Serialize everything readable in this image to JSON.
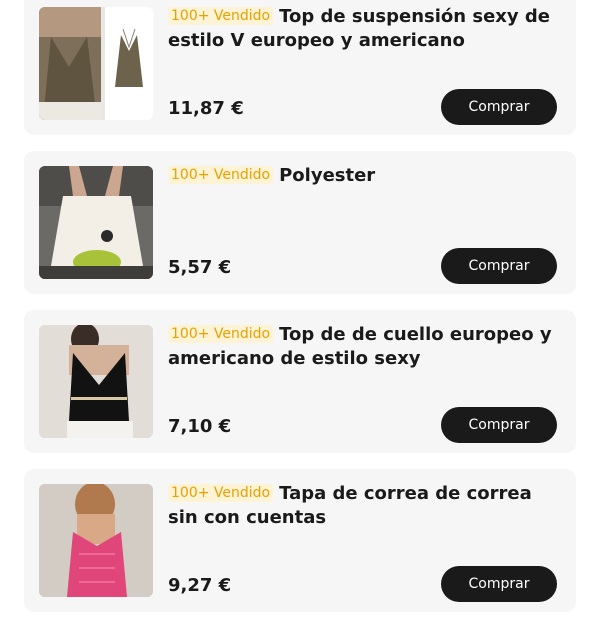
{
  "products": [
    {
      "badge": "100+ Vendido",
      "title": "Top de suspensión sexy de estilo V europeo y americano",
      "price": "11,87 €",
      "button": "Comprar",
      "image_label": "halter-top-olive-photo"
    },
    {
      "badge": "100+ Vendido",
      "title": "Polyester",
      "price": "5,57 €",
      "button": "Comprar",
      "image_label": "white-ruffle-cami-photo"
    },
    {
      "badge": "100+ Vendido",
      "title": "Top de de cuello europeo y americano de estilo sexy",
      "price": "7,10 €",
      "button": "Comprar",
      "image_label": "black-halter-knit-top-photo"
    },
    {
      "badge": "100+ Vendido",
      "title": "Tapa de correa de correa sin con cuentas",
      "price": "9,27 €",
      "button": "Comprar",
      "image_label": "pink-beaded-cami-photo"
    }
  ],
  "colors": {
    "badge_text": "#e6a100",
    "badge_bg": "#fff3d6",
    "button_bg": "#1a1a1a",
    "card_bg": "#f6f6f6"
  }
}
